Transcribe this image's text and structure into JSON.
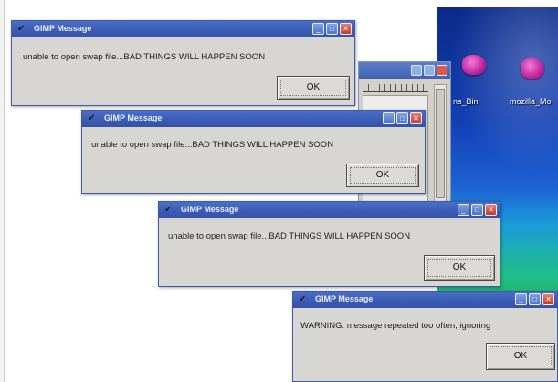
{
  "dialogs": [
    {
      "title": "GIMP Message",
      "message": "unable to open swap file...BAD THINGS WILL HAPPEN SOON",
      "ok_label": "OK"
    },
    {
      "title": "GIMP Message",
      "message": "unable to open swap file...BAD THINGS WILL HAPPEN SOON",
      "ok_label": "OK"
    },
    {
      "title": "GIMP Message",
      "message": "unable to open swap file...BAD THINGS WILL HAPPEN SOON",
      "ok_label": "OK"
    },
    {
      "title": "GIMP Message",
      "message": "WARNING: message repeated too often, ignoring",
      "ok_label": "OK"
    }
  ],
  "desktop": {
    "icons": [
      {
        "label": "ns_Bin"
      },
      {
        "label": "mozilla_Mo"
      }
    ]
  },
  "colors": {
    "titlebar": "#3a5bb4",
    "dialog_bg": "#d8d6d2",
    "close_button": "#c83a2a"
  }
}
